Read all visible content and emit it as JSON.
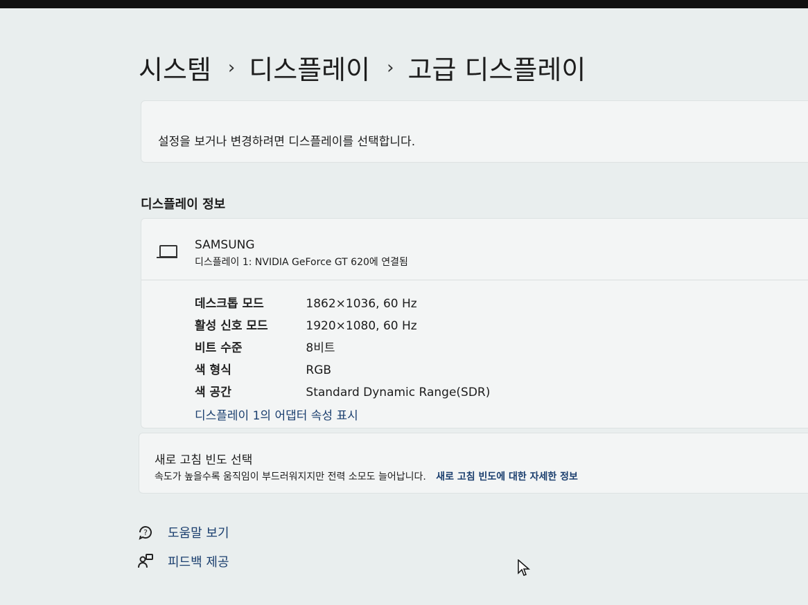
{
  "breadcrumb": {
    "item1": "시스템",
    "sep1": "›",
    "item2": "디스플레이",
    "sep2": "›",
    "item3": "고급 디스플레이"
  },
  "select_prompt": "설정을 보거나 변경하려면 디스플레이를 선택합니다.",
  "section_title": "디스플레이 정보",
  "monitor": {
    "name": "SAMSUNG",
    "subtitle": "디스플레이 1: NVIDIA GeForce GT 620에 연결됨"
  },
  "info_rows": [
    {
      "label": "데스크톱 모드",
      "value": "1862×1036, 60 Hz"
    },
    {
      "label": "활성 신호 모드",
      "value": "1920×1080, 60 Hz"
    },
    {
      "label": "비트 수준",
      "value": "8비트"
    },
    {
      "label": "색 형식",
      "value": "RGB"
    },
    {
      "label": "색 공간",
      "value": "Standard Dynamic Range(SDR)"
    }
  ],
  "adapter_link": "디스플레이 1의 어댑터 속성 표시",
  "refresh": {
    "title": "새로 고침 빈도 선택",
    "description": "속도가 높을수록 움직임이 부드러워지지만 전력 소모도 늘어납니다.",
    "link": "새로 고침 빈도에 대한 자세한 정보"
  },
  "help": {
    "get_help": "도움말 보기",
    "feedback": "피드백 제공"
  },
  "colors": {
    "link": "#1a3e6e",
    "card": "#f3f5f5",
    "background": "#e9eeee"
  }
}
